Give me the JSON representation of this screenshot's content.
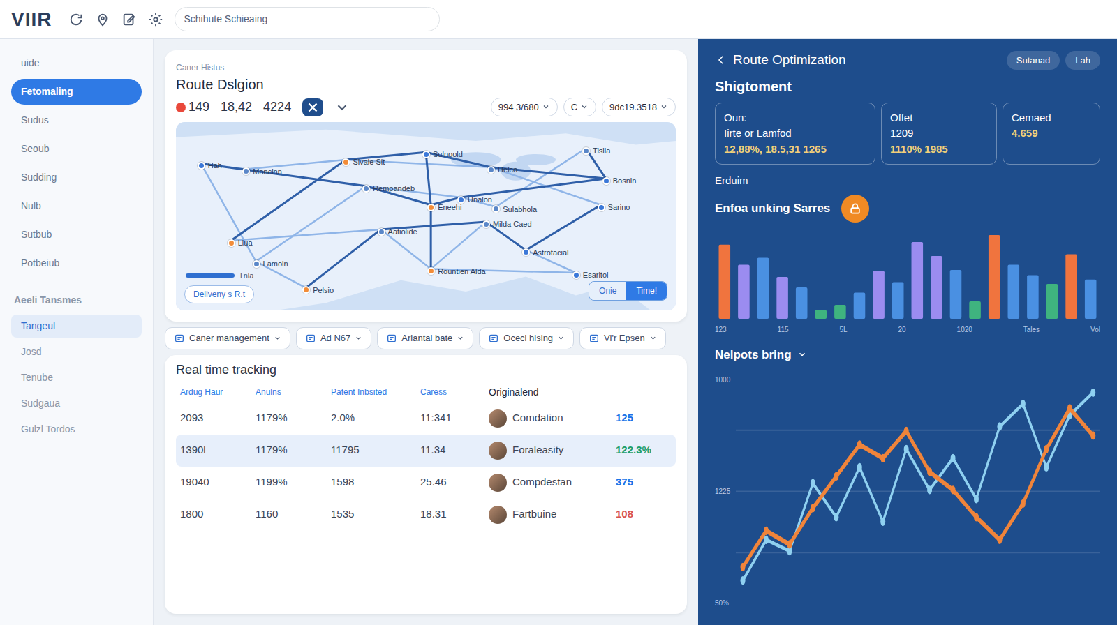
{
  "app": {
    "logo": "VIIR",
    "search": "Schihute Schieaing"
  },
  "sidebar": {
    "items": [
      {
        "label": "uide",
        "selected": false
      },
      {
        "label": "Fetomaling",
        "selected": true
      },
      {
        "label": "Sudus",
        "selected": false
      },
      {
        "label": "Seoub",
        "selected": false
      },
      {
        "label": "Sudding",
        "selected": false
      },
      {
        "label": "Nulb",
        "selected": false
      },
      {
        "label": "Sutbub",
        "selected": false
      },
      {
        "label": "Potbeiub",
        "selected": false
      }
    ],
    "section": "Aeeli Tansmes",
    "sub_items": [
      {
        "label": "Tangeul",
        "selected": true
      },
      {
        "label": "Josd",
        "selected": false
      },
      {
        "label": "Tenube",
        "selected": false
      },
      {
        "label": "Sudgaua",
        "selected": false
      },
      {
        "label": "Gulzl Tordos",
        "selected": false
      }
    ]
  },
  "route_design": {
    "caption": "Caner Histus",
    "title": "Route Dslgion",
    "alert": "149",
    "stats": [
      "18,42",
      "4224"
    ],
    "filters": [
      "994 3/680",
      "C",
      "9dc19.3518"
    ],
    "cities": [
      {
        "label": "Hah",
        "color": "#3b78d8"
      },
      {
        "label": "Mancinn",
        "color": "#5a87c8"
      },
      {
        "label": "Sivale Sit",
        "color": "#f28c38"
      },
      {
        "label": "Rempandeb",
        "color": "#5a87c8"
      },
      {
        "label": "Sulnoold",
        "color": "#3b78d8"
      },
      {
        "label": "Helco",
        "color": "#5a87c8"
      },
      {
        "label": "Unalon",
        "color": "#3b78d8"
      },
      {
        "label": "Sulabhola",
        "color": "#5a87c8"
      },
      {
        "label": "Milda Caed",
        "color": "#5a87c8"
      },
      {
        "label": "Eneehi",
        "color": "#f28c38"
      },
      {
        "label": "Aatiolide",
        "color": "#5a87c8"
      },
      {
        "label": "Rountien Alda",
        "color": "#f28c38"
      },
      {
        "label": "Astrofacial",
        "color": "#3b78d8"
      },
      {
        "label": "Tisila",
        "color": "#5a87c8"
      },
      {
        "label": "Bosnin",
        "color": "#3b78d8"
      },
      {
        "label": "Sarino",
        "color": "#3b78d8"
      },
      {
        "label": "Esaritol",
        "color": "#3b78d8"
      },
      {
        "label": "Liua",
        "color": "#f28c38"
      },
      {
        "label": "Lamoin",
        "color": "#5a87c8"
      },
      {
        "label": "Pelsio",
        "color": "#f28c38"
      }
    ],
    "legend": "Deiiveny s R.t",
    "scale": "Tnla",
    "view": [
      {
        "label": "Onie",
        "selected": false
      },
      {
        "label": "Time!",
        "selected": true
      }
    ]
  },
  "chips": [
    "Caner management",
    "Ad N67",
    "Arlantal bate",
    "Ocecl hising",
    "Vi'r Epsen"
  ],
  "tracking": {
    "title": "Real time tracking",
    "columns": [
      "Ardug Haur",
      "Anulns",
      "Patent Inbsited",
      "Caress"
    ],
    "owner_column": "Originalend",
    "rows": [
      {
        "cells": [
          "2093",
          "1179%",
          "2.0%",
          "11:341"
        ],
        "owner": "Comdation",
        "value": "125",
        "color": "#1a73e8",
        "selected": false
      },
      {
        "cells": [
          "1390l",
          "1179%",
          "11795",
          "11.34"
        ],
        "owner": "Foraleasity",
        "value": "122.3%",
        "color": "#1e9e6a",
        "selected": true
      },
      {
        "cells": [
          "19040",
          "1199%",
          "1598",
          "25.46"
        ],
        "owner": "Compdestan",
        "value": "375",
        "color": "#1a73e8",
        "selected": false
      },
      {
        "cells": [
          "1800",
          "1160",
          "1535",
          "18.31"
        ],
        "owner": "Fartbuine",
        "value": "108",
        "color": "#d9534f",
        "selected": false
      }
    ]
  },
  "optimization": {
    "title": "Route Optimization",
    "search": "Sutanad",
    "action": "Lah",
    "section": "Shigtoment",
    "kpis": [
      {
        "label": "Oun:",
        "lines": [
          "Iirte or Lamfod",
          "12,88%, 18.5,31 1265"
        ]
      },
      {
        "label": "Offet",
        "lines": [
          "1209",
          "1110%  1985"
        ]
      },
      {
        "label": "Cemaed",
        "lines": [
          "4.659"
        ]
      }
    ],
    "bars": {
      "subtitle": "Erduim",
      "title": "Enfoa unking Sarres",
      "items": [
        {
          "value": 85,
          "color": "#f0743e"
        },
        {
          "value": 62,
          "color": "#9b8cf0"
        },
        {
          "value": 70,
          "color": "#4a90e2"
        },
        {
          "value": 48,
          "color": "#9b8cf0"
        },
        {
          "value": 36,
          "color": "#4a90e2"
        },
        {
          "value": 10,
          "color": "#3fb37f"
        },
        {
          "value": 16,
          "color": "#3fb37f"
        },
        {
          "value": 30,
          "color": "#4a90e2"
        },
        {
          "value": 55,
          "color": "#9b8cf0"
        },
        {
          "value": 42,
          "color": "#4a90e2"
        },
        {
          "value": 88,
          "color": "#9b8cf0"
        },
        {
          "value": 72,
          "color": "#9b8cf0"
        },
        {
          "value": 56,
          "color": "#4a90e2"
        },
        {
          "value": 20,
          "color": "#3fb37f"
        },
        {
          "value": 96,
          "color": "#f0743e"
        },
        {
          "value": 62,
          "color": "#4a90e2"
        },
        {
          "value": 50,
          "color": "#4a90e2"
        },
        {
          "value": 40,
          "color": "#3fb37f"
        },
        {
          "value": 74,
          "color": "#f0743e"
        },
        {
          "value": 45,
          "color": "#4a90e2"
        }
      ],
      "ticks": [
        "123",
        "115",
        "5L",
        "20",
        "1020",
        "Tales",
        "Vol"
      ]
    },
    "lines": {
      "title": "Nelpots bring",
      "y_ticks": [
        "1000",
        "1225",
        "50%"
      ],
      "series": [
        {
          "color": "#8fd0f0",
          "values": [
            12,
            30,
            25,
            55,
            40,
            62,
            38,
            70,
            52,
            66,
            48,
            80,
            90,
            62,
            85,
            95
          ]
        },
        {
          "color": "#f0843a",
          "values": [
            18,
            34,
            28,
            44,
            58,
            72,
            66,
            78,
            60,
            52,
            40,
            30,
            46,
            70,
            88,
            76
          ]
        }
      ]
    }
  }
}
